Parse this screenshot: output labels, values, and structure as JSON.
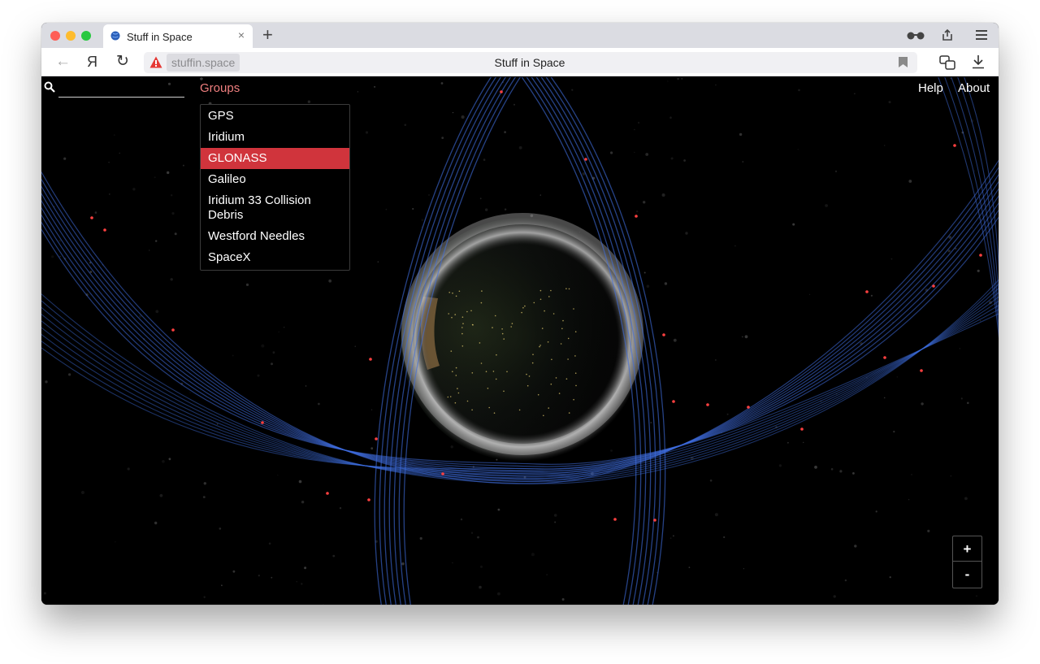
{
  "browser": {
    "tab_title": "Stuff in Space",
    "tab_close": "×",
    "new_tab": "+",
    "back": "←",
    "yandex_logo": "Я",
    "reload": "↻",
    "url_host": "stuffin.space",
    "page_title": "Stuff in Space",
    "icons": [
      "glasses-icon",
      "share-icon",
      "menu-icon",
      "bookmark-icon",
      "sidebar-icon",
      "download-icon",
      "warning-icon"
    ]
  },
  "app": {
    "search_placeholder": "",
    "groups_label": "Groups",
    "groups": [
      {
        "label": "GPS",
        "active": false
      },
      {
        "label": "Iridium",
        "active": false
      },
      {
        "label": "GLONASS",
        "active": true
      },
      {
        "label": "Galileo",
        "active": false
      },
      {
        "label": "Iridium 33 Collision Debris",
        "active": false
      },
      {
        "label": "Westford Needles",
        "active": false
      },
      {
        "label": "SpaceX",
        "active": false
      }
    ],
    "help_label": "Help",
    "about_label": "About",
    "zoom_in": "+",
    "zoom_out": "-"
  },
  "colors": {
    "orbit_lines": "#3f6ee0",
    "satellites_highlight": "#ff4040",
    "groups_link": "#f07f7f",
    "active_group": "#d0343c"
  }
}
